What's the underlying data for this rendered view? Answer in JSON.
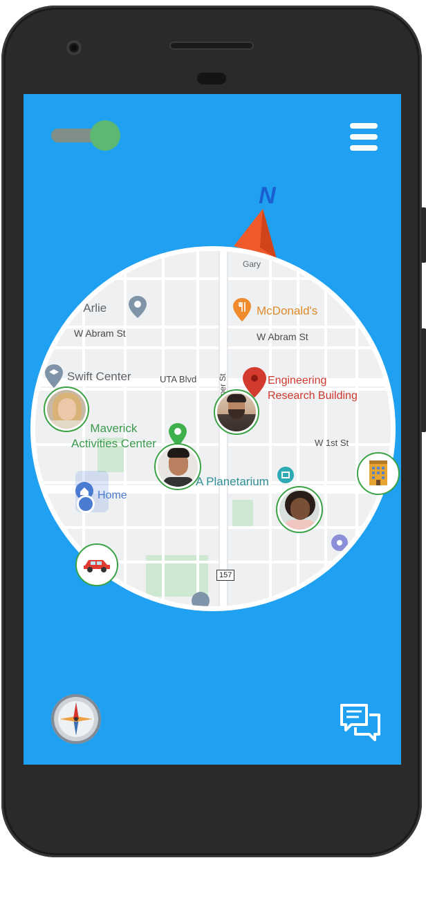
{
  "map": {
    "labels": {
      "gary": "Gary",
      "arlie": "e Arlie",
      "mcdonalds": "McDonald's",
      "abram_left": "W Abram St",
      "abram_right": "W Abram St",
      "swift_center": "Swift Center",
      "uta_blvd": "UTA Blvd",
      "cooper_st": "oper St",
      "engineering_line1": "Engineering",
      "engineering_line2": "Research Building",
      "maverick_line1": "Maverick",
      "maverick_line2": "Activities Center",
      "first_st": "W 1st St",
      "planetarium": "A Planetarium",
      "home": "Home",
      "route_157": "157"
    }
  },
  "icons": {
    "toggle": "toggle-switch",
    "menu": "hamburger-menu-icon",
    "north": "north-arrow-icon",
    "compass": "compass-icon",
    "chat": "chat-bubbles-icon",
    "car": "car-icon",
    "building": "office-building-icon"
  },
  "colors": {
    "screen_bg": "#1fa0f0",
    "toggle_on": "#5cb873",
    "avatar_ring": "#3aa245",
    "north_arrow": "#f05a2a",
    "pin_red": "#d33b2e"
  }
}
